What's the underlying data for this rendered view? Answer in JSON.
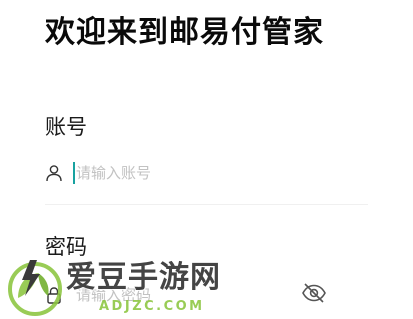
{
  "header": {
    "welcome_title": "欢迎来到邮易付管家"
  },
  "account": {
    "label": "账号",
    "value": "",
    "placeholder": "请输入账号",
    "icon": "user-icon"
  },
  "password": {
    "label": "密码",
    "value": "",
    "placeholder": "请输入密码",
    "icon": "lock-icon",
    "visibility_icon": "eye-off-icon"
  },
  "watermark": {
    "brand": "爱豆手游网",
    "domain": "ADJZC.COM"
  },
  "colors": {
    "caret": "#18a2a0",
    "placeholder": "#c2c2c2",
    "watermark_green": "#8cc63f"
  }
}
